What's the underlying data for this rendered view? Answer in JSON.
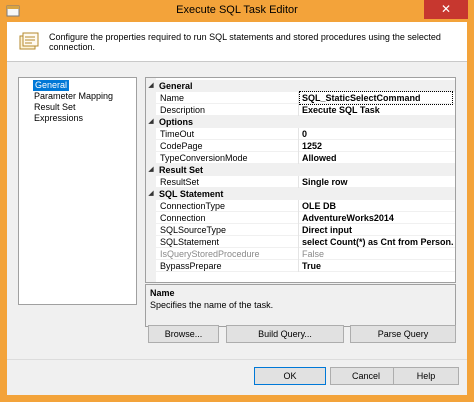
{
  "window": {
    "title": "Execute SQL Task Editor",
    "close_glyph": "✕"
  },
  "header": {
    "text": "Configure the properties required to run SQL statements and stored procedures using the selected connection."
  },
  "nav": {
    "items": [
      {
        "label": "General",
        "selected": true
      },
      {
        "label": "Parameter Mapping",
        "selected": false
      },
      {
        "label": "Result Set",
        "selected": false
      },
      {
        "label": "Expressions",
        "selected": false
      }
    ]
  },
  "grid": {
    "categories": {
      "general": "General",
      "options": "Options",
      "result_set": "Result Set",
      "sql_statement": "SQL Statement"
    },
    "props": {
      "name": {
        "label": "Name",
        "value": "SQL_StaticSelectCommand"
      },
      "description": {
        "label": "Description",
        "value": "Execute SQL Task"
      },
      "timeout": {
        "label": "TimeOut",
        "value": "0"
      },
      "codepage": {
        "label": "CodePage",
        "value": "1252"
      },
      "type_conversion": {
        "label": "TypeConversionMode",
        "value": "Allowed"
      },
      "resultset": {
        "label": "ResultSet",
        "value": "Single row"
      },
      "connection_type": {
        "label": "ConnectionType",
        "value": "OLE DB"
      },
      "connection": {
        "label": "Connection",
        "value": "AdventureWorks2014"
      },
      "sql_source_type": {
        "label": "SQLSourceType",
        "value": "Direct input"
      },
      "sql_statement": {
        "label": "SQLStatement",
        "value": "select Count(*) as Cnt from Person.Person"
      },
      "is_query_sp": {
        "label": "IsQueryStoredProcedure",
        "value": "False"
      },
      "bypass_prepare": {
        "label": "BypassPrepare",
        "value": "True"
      }
    },
    "collapse_glyph": "◢"
  },
  "description": {
    "title": "Name",
    "text": "Specifies the name of the task."
  },
  "buttons": {
    "browse": "Browse...",
    "build_query": "Build Query...",
    "parse_query": "Parse Query",
    "ok": "OK",
    "cancel": "Cancel",
    "help": "Help"
  },
  "colors": {
    "accent": "#f3a33a",
    "selection": "#0078d7",
    "close": "#c7372f"
  }
}
